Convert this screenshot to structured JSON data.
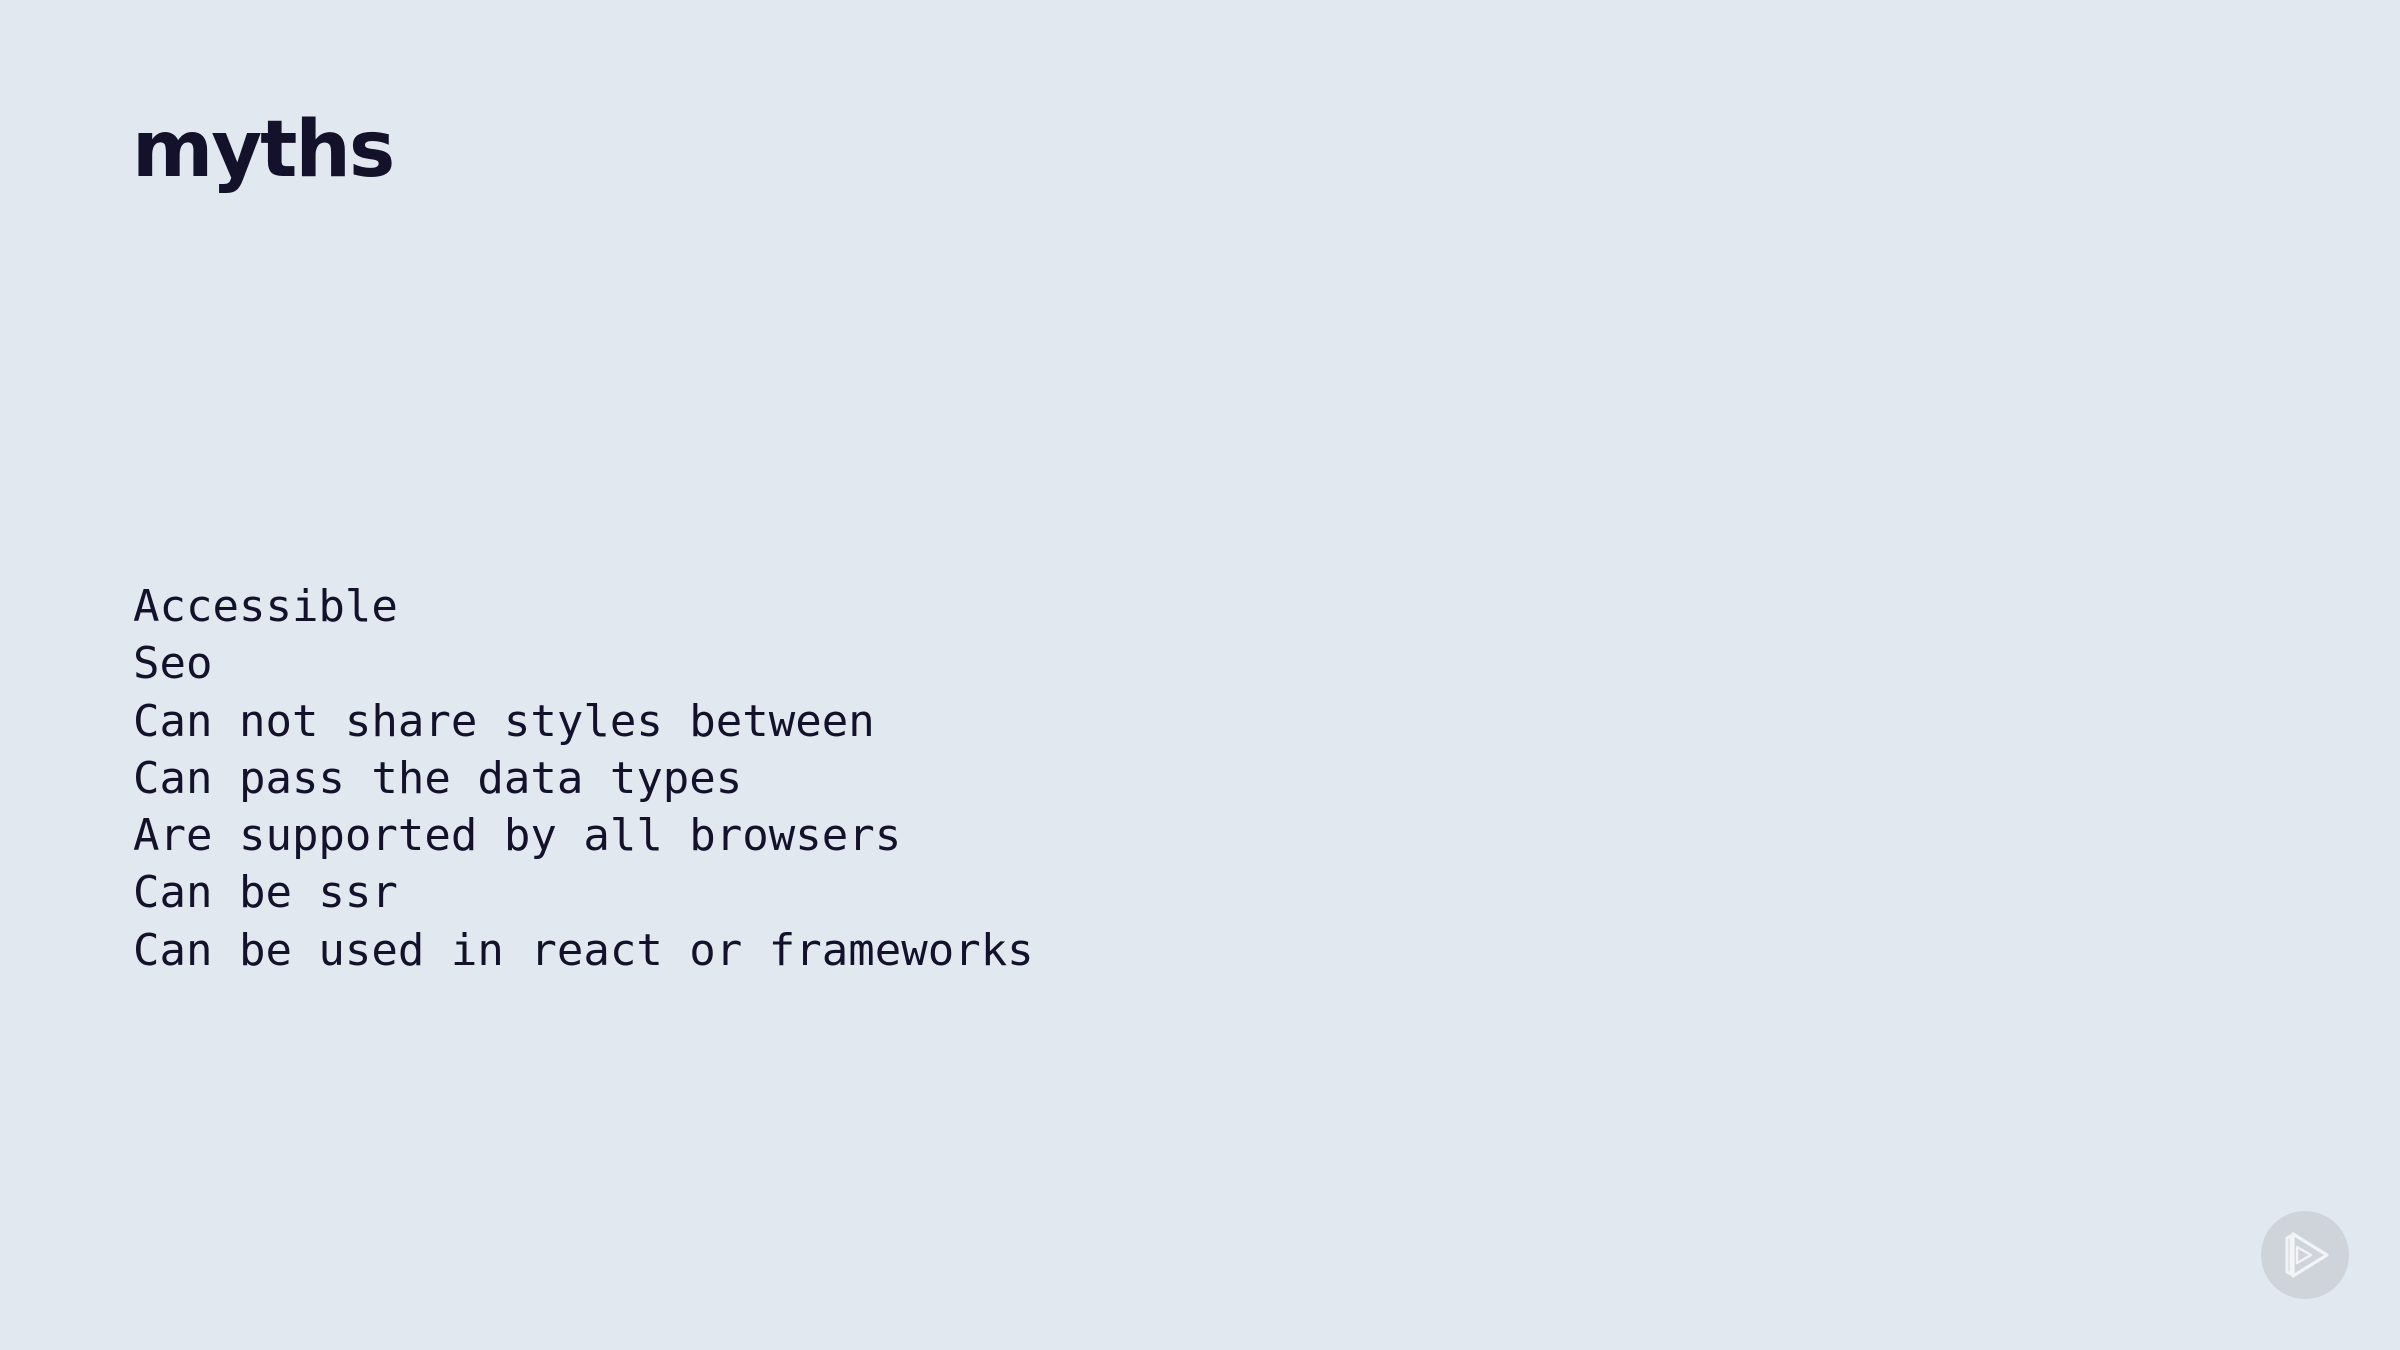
{
  "slide": {
    "title": "myths",
    "items": [
      "Accessible",
      "Seo",
      "Can not share styles between",
      "Can pass the data types",
      "Are supported by all browsers",
      "Can be ssr",
      "Can be used in react or frameworks"
    ]
  },
  "colors": {
    "background": "#e1e8f0",
    "text": "#13122a",
    "badge": "#cfd3da",
    "badge_icon": "#f2f4f7"
  },
  "icons": {
    "badge": "play-icon"
  }
}
